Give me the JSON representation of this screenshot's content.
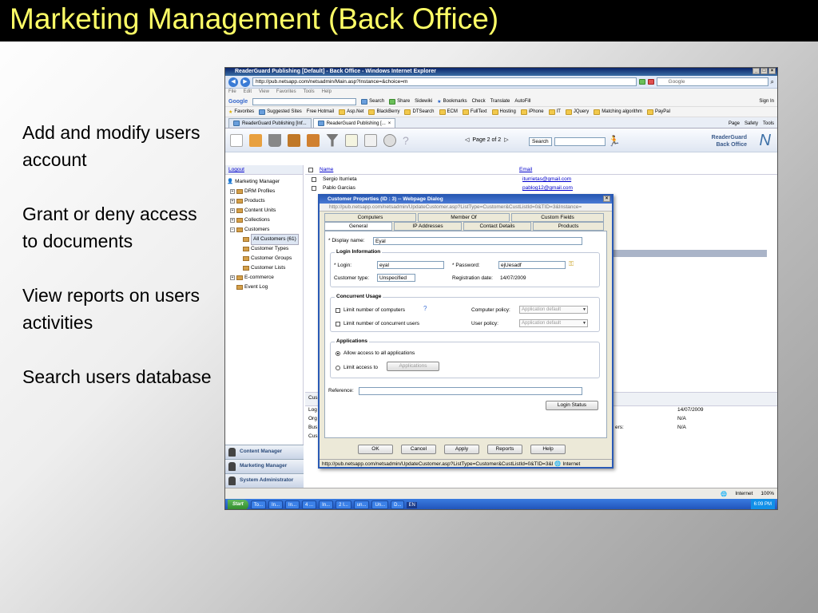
{
  "slide": {
    "title": "Marketing Management (Back Office)",
    "bullets": [
      "Add and modify users account",
      "Grant or deny access to documents",
      "View reports on users activities",
      "Search users database"
    ]
  },
  "ie": {
    "window_title": "ReaderGuard Publishing [Default] - Back Office - Windows Internet Explorer",
    "address": "http://pub.netsapp.com/netsadmin/Main.asp?Instance=&choice=m",
    "search_placeholder": "Google",
    "menu": [
      "File",
      "Edit",
      "View",
      "Favorites",
      "Tools",
      "Help"
    ],
    "google_toolbar": [
      "Search",
      "Share",
      "Sidewiki",
      "Bookmarks",
      "Check",
      "Translate",
      "AutoFill",
      "Sign In"
    ],
    "google_label": "Google",
    "favorites_label": "Favorites",
    "favorites": [
      "Suggested Sites",
      "Free Hotmail",
      "Asp.Net",
      "BlackBerry",
      "DTSearch",
      "ECM",
      "FullText",
      "Hosting",
      "iPhone",
      "IT",
      "JQuery",
      "Matching algorithm",
      "PayPal"
    ],
    "tabs": [
      "ReaderGuard Publishing [Inf...",
      "ReaderGuard Publishing [..."
    ],
    "cmd": [
      "Page",
      "Safety",
      "Tools"
    ]
  },
  "app": {
    "pager": "Page 2 of 2",
    "search_select": "Search",
    "brand_line1": "ReaderGuard",
    "brand_line2": "Back Office",
    "logout": "Logout",
    "tree": [
      {
        "label": "Marketing Manager",
        "level": 0
      },
      {
        "label": "DRM Profiles",
        "level": 1
      },
      {
        "label": "Products",
        "level": 1
      },
      {
        "label": "Content Units",
        "level": 1
      },
      {
        "label": "Collections",
        "level": 1
      },
      {
        "label": "Customers",
        "level": 1
      },
      {
        "label": "All Customers (61)",
        "level": 2
      },
      {
        "label": "Customer Types",
        "level": 2
      },
      {
        "label": "Customer Groups",
        "level": 2
      },
      {
        "label": "Customer Lists",
        "level": 2
      },
      {
        "label": "E-commerce",
        "level": 1
      },
      {
        "label": "Event Log",
        "level": 1
      }
    ],
    "bottom_nav": [
      "Content Manager",
      "Marketing Manager",
      "System Administrator"
    ],
    "grid": {
      "col_name": "Name",
      "col_email": "Email",
      "rows": [
        {
          "name": "Sergio Iturrieta",
          "email": "iturrietas@gmail.com"
        },
        {
          "name": "Pablo Garcias",
          "email": "pablog12@gmail.com"
        }
      ],
      "info_labels": [
        "Cus",
        "Log",
        "Org",
        "Bus",
        "Cus"
      ],
      "info_values": [
        "14/07/2009",
        "N/A",
        "N/A"
      ],
      "info_mid": "ers:"
    },
    "status_zone": "Internet",
    "zoom": "100%"
  },
  "dialog": {
    "title": "Customer Properties (ID : 3) -- Webpage Dialog",
    "url": "http://pub.netsapp.com/netsadmin/UpdateCustomer.asp?ListType=Customer&CustListId=0&TID=3&Instance=",
    "tabs_back": [
      "Computers",
      "Member Of",
      "Custom Fields"
    ],
    "tabs_front": [
      "General",
      "IP Addresses",
      "Contact Details",
      "Products"
    ],
    "display_name_label": "* Display name:",
    "display_name": "Eyal",
    "login_info_label": "Login Information",
    "login_label": "* Login:",
    "login": "eyal",
    "password_label": "* Password:",
    "password": "ejUesadf",
    "customer_type_label": "Customer type:",
    "customer_type": "Unspecified",
    "reg_date_label": "Registration date:",
    "reg_date": "14/07/2009",
    "concurrent_label": "Concurrent Usage",
    "limit_computers": "Limit number of computers",
    "computer_policy_label": "Computer policy:",
    "computer_policy": "Application default",
    "limit_users": "Limit number of concurrent users",
    "user_policy_label": "User policy:",
    "user_policy": "Application default",
    "apps_label": "Applications",
    "allow_all": "Allow access to all applications",
    "limit_access": "Limit access to",
    "applications_btn": "Applications",
    "reference_label": "Reference:",
    "login_status_btn": "Login Status",
    "buttons": [
      "OK",
      "Cancel",
      "Apply",
      "Reports",
      "Help"
    ],
    "status_url": "http://pub.netsapp.com/netsadmin/UpdateCustomer.asp?ListType=Customer&CustListId=0&TID=3&I",
    "status_zone": "Internet"
  },
  "taskbar": {
    "start": "Start",
    "items": [
      "To...",
      "In...",
      "In...",
      "4 ...",
      "In...",
      "2 I...",
      "un...",
      "Un...",
      "D..."
    ],
    "lang": "EN",
    "clock": "6:09 PM"
  }
}
